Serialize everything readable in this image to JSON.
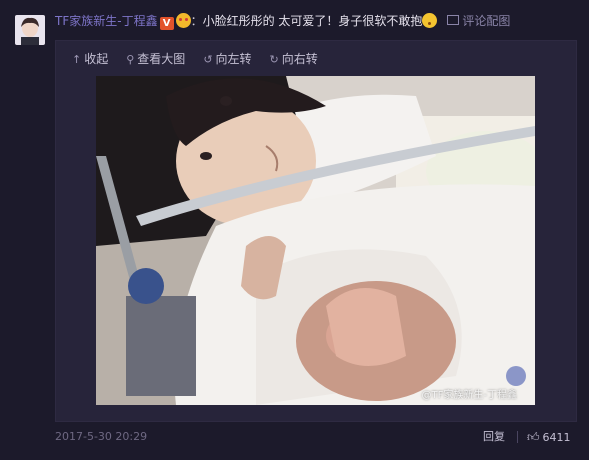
{
  "post": {
    "username": "TF家族新生-丁程鑫",
    "verified_badge": "V",
    "separator": "：",
    "text": "小脸红彤彤的 太可爱了！身子很软不敢抱",
    "comment_with_pic": "评论配图"
  },
  "toolbar": {
    "collapse": "收起",
    "view_large": "查看大图",
    "rotate_left": "向左转",
    "rotate_right": "向右转"
  },
  "photo": {
    "watermark": "@TF家族新生-丁程鑫"
  },
  "footer": {
    "timestamp": "2017-5-30 20:29",
    "reply": "回复",
    "like_count": "6411"
  },
  "colors": {
    "background": "#1c1a2b",
    "username": "#7d74c8",
    "badge": "#e2532b"
  }
}
